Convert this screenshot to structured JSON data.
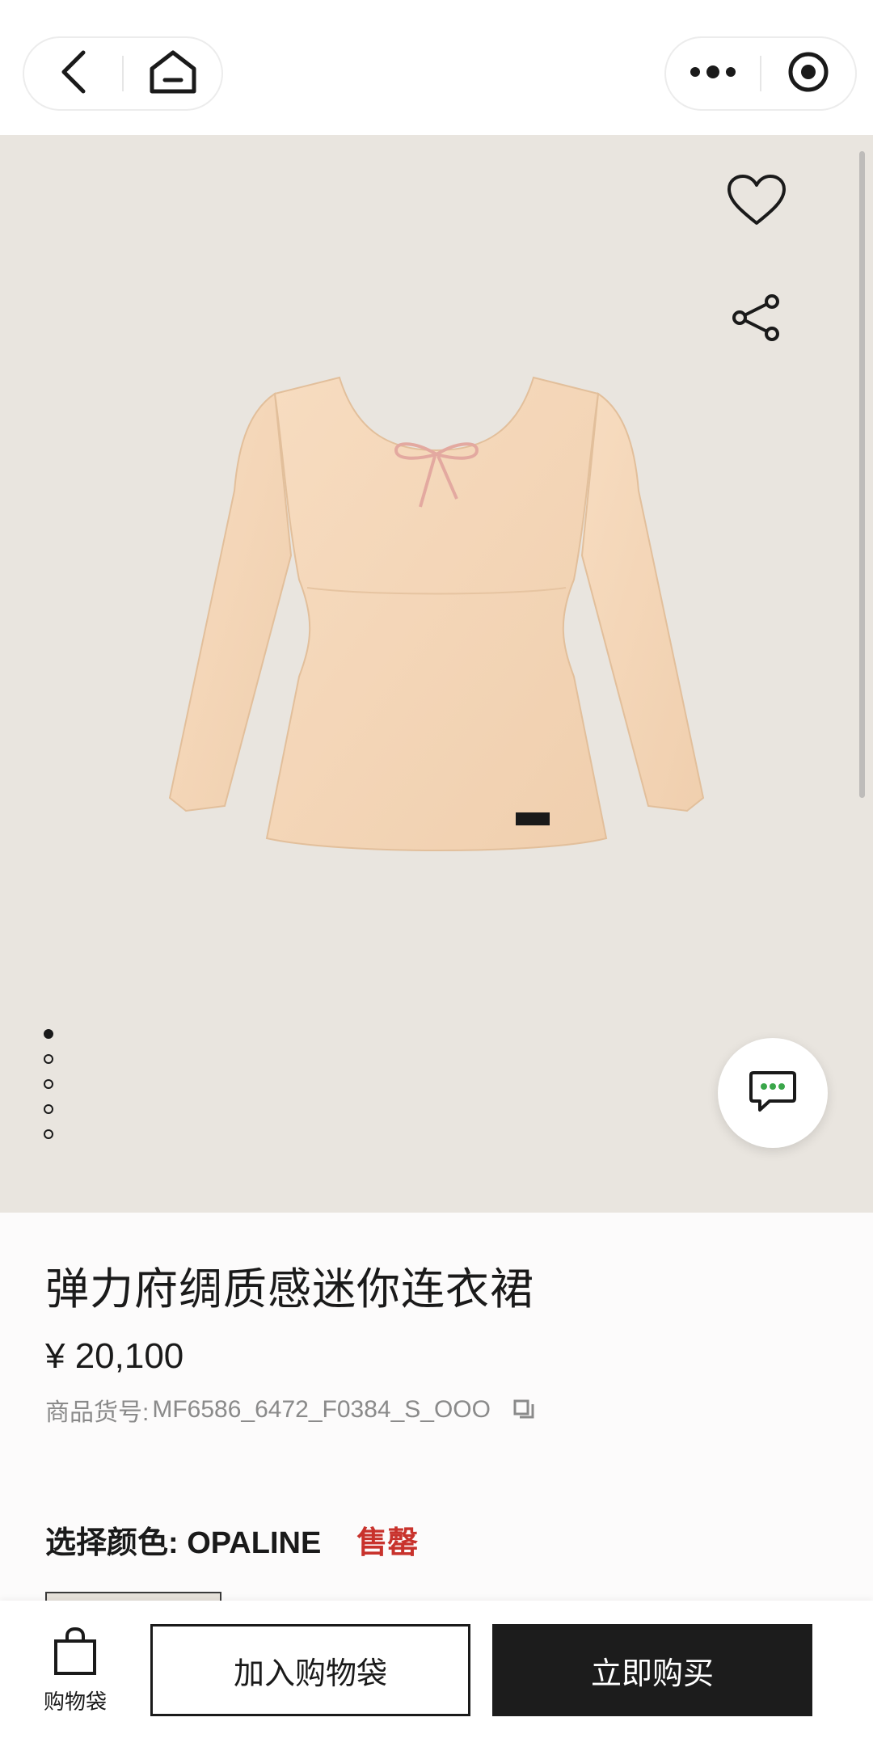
{
  "nav": {
    "back_icon": "chevron-left-icon",
    "home_icon": "home-icon",
    "more_icon": "more-dots-icon",
    "target_icon": "record-target-icon"
  },
  "hero": {
    "image_icon": "dress-image",
    "favorite_icon": "heart-icon",
    "share_icon": "share-icon",
    "chat_icon": "chat-bubble-icon",
    "slides_total": 5,
    "slide_active": 1,
    "background_color": "#e9e5df"
  },
  "product": {
    "title": "弹力府绸质感迷你连衣裙",
    "price": "¥ 20,100",
    "sku_label": "商品货号:",
    "sku_value": "MF6586_6472_F0384_S_OOO",
    "color_label": "选择颜色: OPALINE",
    "status": "售罄",
    "status_color": "#c8322c"
  },
  "bottom_bar": {
    "bag_label": "购物袋",
    "add_to_bag": "加入购物袋",
    "buy_now": "立即购买"
  }
}
